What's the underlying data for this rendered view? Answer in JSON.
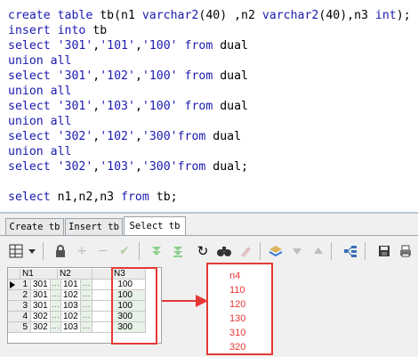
{
  "editor": {
    "lines": [
      {
        "parts": [
          {
            "t": "create",
            "c": "kw"
          },
          {
            "t": " table ",
            "c": "kw"
          },
          {
            "t": "tb(n1 ",
            "c": "id"
          },
          {
            "t": "varchar2",
            "c": "fn"
          },
          {
            "t": "(40)",
            "c": "num"
          },
          {
            "t": " ,n2 ",
            "c": "id"
          },
          {
            "t": "varchar2",
            "c": "fn"
          },
          {
            "t": "(40)",
            "c": "num"
          },
          {
            "t": ",n3 ",
            "c": "id"
          },
          {
            "t": "int",
            "c": "kw"
          },
          {
            "t": ");",
            "c": "id"
          }
        ]
      },
      {
        "parts": [
          {
            "t": "insert into ",
            "c": "kw"
          },
          {
            "t": "tb",
            "c": "id"
          }
        ]
      },
      {
        "parts": [
          {
            "t": "select ",
            "c": "kw"
          },
          {
            "t": "'301'",
            "c": "str"
          },
          {
            "t": ",",
            "c": "id"
          },
          {
            "t": "'101'",
            "c": "str"
          },
          {
            "t": ",",
            "c": "id"
          },
          {
            "t": "'100'",
            "c": "str"
          },
          {
            "t": " from ",
            "c": "kw"
          },
          {
            "t": "dual",
            "c": "id"
          }
        ]
      },
      {
        "parts": [
          {
            "t": "union all",
            "c": "kw"
          }
        ]
      },
      {
        "parts": [
          {
            "t": "select ",
            "c": "kw"
          },
          {
            "t": "'301'",
            "c": "str"
          },
          {
            "t": ",",
            "c": "id"
          },
          {
            "t": "'102'",
            "c": "str"
          },
          {
            "t": ",",
            "c": "id"
          },
          {
            "t": "'100'",
            "c": "str"
          },
          {
            "t": " from ",
            "c": "kw"
          },
          {
            "t": "dual",
            "c": "id"
          }
        ]
      },
      {
        "parts": [
          {
            "t": "union all",
            "c": "kw"
          }
        ]
      },
      {
        "parts": [
          {
            "t": "select ",
            "c": "kw"
          },
          {
            "t": "'301'",
            "c": "str"
          },
          {
            "t": ",",
            "c": "id"
          },
          {
            "t": "'103'",
            "c": "str"
          },
          {
            "t": ",",
            "c": "id"
          },
          {
            "t": "'100'",
            "c": "str"
          },
          {
            "t": " from ",
            "c": "kw"
          },
          {
            "t": "dual",
            "c": "id"
          }
        ]
      },
      {
        "parts": [
          {
            "t": "union all",
            "c": "kw"
          }
        ]
      },
      {
        "parts": [
          {
            "t": "select ",
            "c": "kw"
          },
          {
            "t": "'302'",
            "c": "str"
          },
          {
            "t": ",",
            "c": "id"
          },
          {
            "t": "'102'",
            "c": "str"
          },
          {
            "t": ",",
            "c": "id"
          },
          {
            "t": "'300'",
            "c": "str"
          },
          {
            "t": "from ",
            "c": "kw"
          },
          {
            "t": "dual",
            "c": "id"
          }
        ]
      },
      {
        "parts": [
          {
            "t": "union all",
            "c": "kw"
          }
        ]
      },
      {
        "parts": [
          {
            "t": "select ",
            "c": "kw"
          },
          {
            "t": "'302'",
            "c": "str"
          },
          {
            "t": ",",
            "c": "id"
          },
          {
            "t": "'103'",
            "c": "str"
          },
          {
            "t": ",",
            "c": "id"
          },
          {
            "t": "'300'",
            "c": "str"
          },
          {
            "t": "from ",
            "c": "kw"
          },
          {
            "t": "dual;",
            "c": "id"
          }
        ]
      },
      {
        "parts": []
      },
      {
        "parts": [
          {
            "t": "select ",
            "c": "kw"
          },
          {
            "t": "n1,n2,n3 ",
            "c": "id"
          },
          {
            "t": "from ",
            "c": "kw"
          },
          {
            "t": "tb;",
            "c": "id"
          }
        ]
      }
    ]
  },
  "tabs": [
    {
      "label": "Create tb",
      "active": false
    },
    {
      "label": "Insert tb",
      "active": false
    },
    {
      "label": "Select tb",
      "active": true
    }
  ],
  "toolbar": {
    "icons": [
      "grid-view-icon",
      "dropdown-arrow-icon",
      "lock-icon",
      "add-row-icon",
      "delete-row-icon",
      "post-check-icon",
      "first-record-icon",
      "last-record-icon",
      "refresh-icon",
      "find-icon",
      "clear-icon",
      "export-icon",
      "next-icon",
      "prev-icon",
      "query-plan-icon",
      "save-icon",
      "print-icon"
    ]
  },
  "grid": {
    "columns": [
      "N1",
      "N2",
      "N3"
    ],
    "rows": [
      {
        "num": "1",
        "n1": "301",
        "n2": "101",
        "n3": "100",
        "current": true
      },
      {
        "num": "2",
        "n1": "301",
        "n2": "102",
        "n3": "100"
      },
      {
        "num": "3",
        "n1": "301",
        "n2": "103",
        "n3": "100"
      },
      {
        "num": "4",
        "n1": "302",
        "n2": "102",
        "n3": "300"
      },
      {
        "num": "5",
        "n1": "302",
        "n2": "103",
        "n3": "300"
      }
    ],
    "ellipsis": "···"
  },
  "result_list": [
    "n4",
    "110",
    "120",
    "130",
    "310",
    "320"
  ],
  "colors": {
    "highlight": "#e53935",
    "keyword": "#1a1ab0"
  }
}
